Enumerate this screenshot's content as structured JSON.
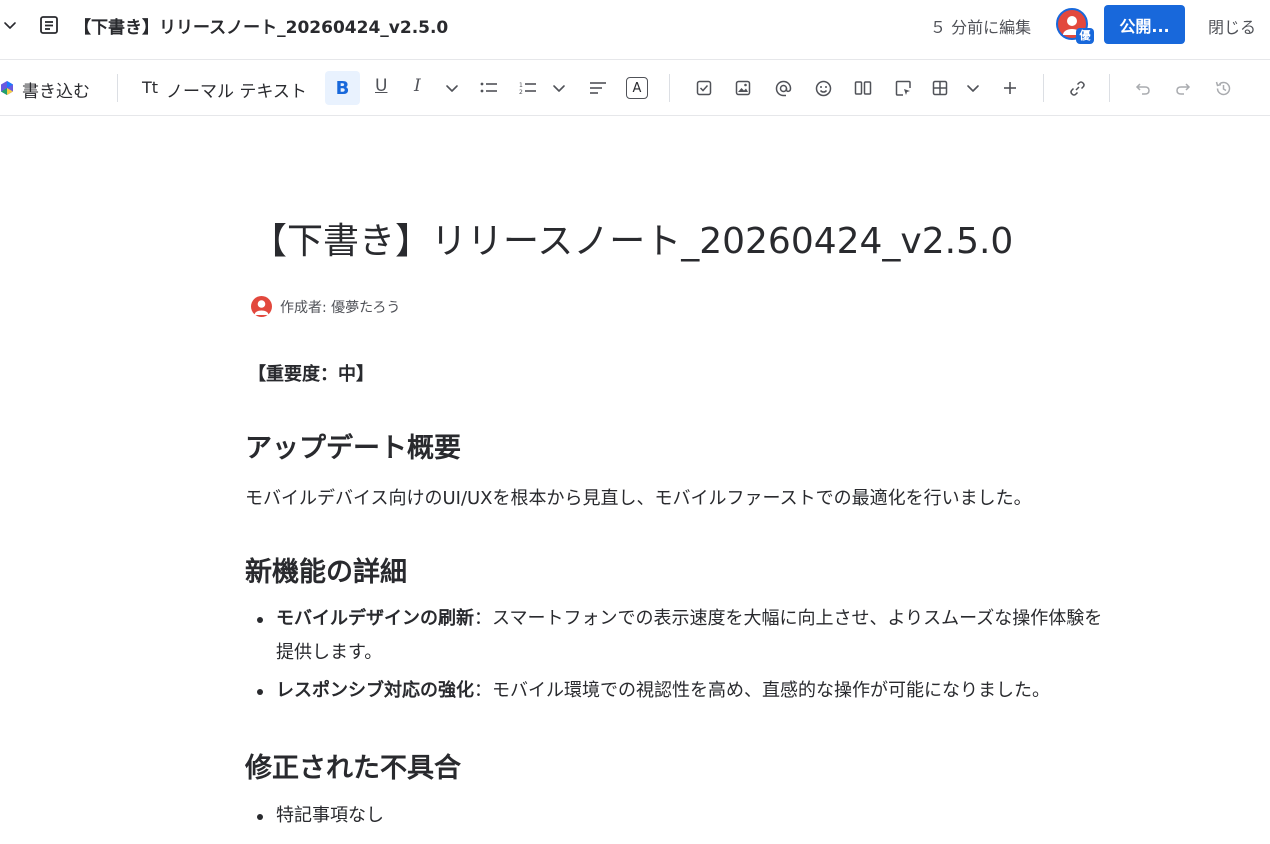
{
  "topbar": {
    "title": "【下書き】リリースノート_20260424_v2.5.0",
    "edited": "５ 分前に編集",
    "avatar_badge": "優",
    "publish_label": "公開...",
    "close_label": "閉じる"
  },
  "toolbar": {
    "ai_label": "書き込む",
    "tt_label": "Tt",
    "text_style_label": "ノーマル テキスト",
    "bold_label": "B",
    "underline_label": "U",
    "italic_label": "I",
    "color_label": "A"
  },
  "document": {
    "title": "【下書き】リリースノート_20260424_v2.5.0",
    "byline": "作成者: 優夢たろう",
    "importance": "【重要度：中】",
    "sections": [
      {
        "heading": "アップデート概要"
      },
      {
        "heading": "新機能の詳細"
      },
      {
        "heading": "修正された不具合"
      }
    ],
    "overview_text": "モバイルデバイス向けのUI/UXを根本から見直し、モバイルファーストでの最適化を行いました。",
    "features": [
      {
        "bold": "モバイルデザインの刷新",
        "text_line1": "：スマートフォンでの表示速度を大幅に向上させ、よりスムーズな操作体験を",
        "text_line2": "提供します。"
      },
      {
        "bold": "レスポンシブ対応の強化",
        "text_line1": "：モバイル環境での視認性を高め、直感的な操作が可能になりました。"
      }
    ],
    "fixes": [
      "特記事項なし"
    ]
  }
}
